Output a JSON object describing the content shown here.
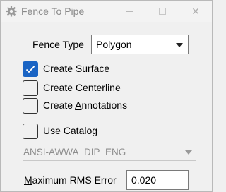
{
  "window": {
    "title": "Fence To Pipe",
    "close_glyph": "✕"
  },
  "fence_type": {
    "label": "Fence Type",
    "value": "Polygon"
  },
  "checkboxes": {
    "create_surface": {
      "pre": "Create ",
      "key": "S",
      "post": "urface",
      "checked": true
    },
    "create_centerline": {
      "pre": "Create ",
      "key": "C",
      "post": "enterline",
      "checked": false
    },
    "create_annotations": {
      "pre": "Create ",
      "key": "A",
      "post": "nnotations",
      "checked": false
    },
    "use_catalog": {
      "label": "Use Catalog",
      "checked": false
    }
  },
  "catalog": {
    "value": "ANSI-AWWA_DIP_ENG",
    "enabled": false
  },
  "rms": {
    "label_key": "M",
    "label_rest": "aximum RMS Error",
    "value": "0.020"
  },
  "colors": {
    "accent": "#1a64c4",
    "disabled_text": "#8d8d8d"
  }
}
